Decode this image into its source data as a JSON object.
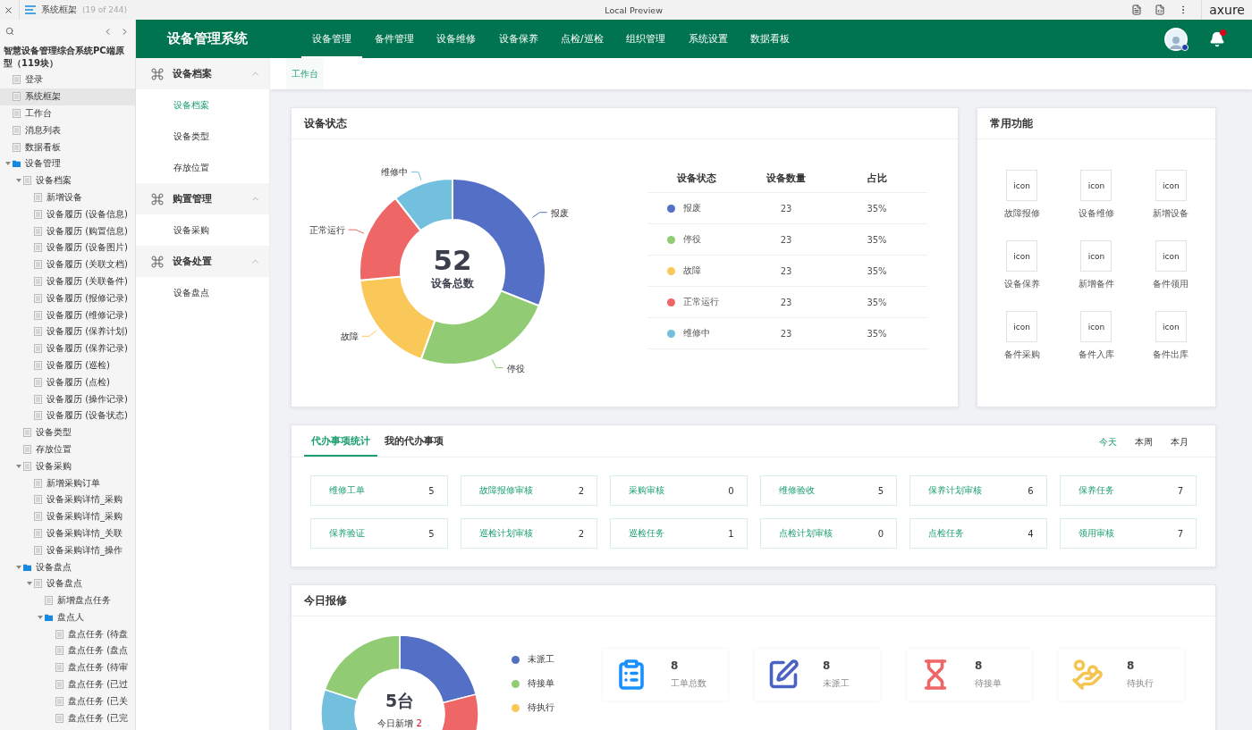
{
  "axure": {
    "title": "系统框架",
    "page_count": "(19 of 244)",
    "preview": "Local Preview",
    "logo": "axure"
  },
  "project": {
    "title": "智慧设备管理综合系统PC端原型（119块）"
  },
  "tree": [
    {
      "label": "登录",
      "kind": "page",
      "selected": false
    },
    {
      "label": "系统框架",
      "kind": "page",
      "selected": true
    },
    {
      "label": "工作台",
      "kind": "page",
      "selected": false
    },
    {
      "label": "消息列表",
      "kind": "page",
      "selected": false
    },
    {
      "label": "数据看板",
      "kind": "page",
      "selected": false
    },
    {
      "label": "设备管理",
      "kind": "folder",
      "selected": false,
      "expanded": true,
      "children": [
        {
          "label": "设备档案",
          "kind": "page",
          "selected": false,
          "expanded": true,
          "children": [
            {
              "label": "新增设备",
              "kind": "page",
              "selected": false
            },
            {
              "label": "设备履历 (设备信息)",
              "kind": "page",
              "selected": false
            },
            {
              "label": "设备履历 (购置信息)",
              "kind": "page",
              "selected": false
            },
            {
              "label": "设备履历 (设备图片)",
              "kind": "page",
              "selected": false
            },
            {
              "label": "设备履历 (关联文档)",
              "kind": "page",
              "selected": false
            },
            {
              "label": "设备履历 (关联备件)",
              "kind": "page",
              "selected": false
            },
            {
              "label": "设备履历 (报修记录)",
              "kind": "page",
              "selected": false
            },
            {
              "label": "设备履历 (维修记录)",
              "kind": "page",
              "selected": false
            },
            {
              "label": "设备履历 (保养计划)",
              "kind": "page",
              "selected": false
            },
            {
              "label": "设备履历 (保养记录)",
              "kind": "page",
              "selected": false
            },
            {
              "label": "设备履历 (巡检)",
              "kind": "page",
              "selected": false
            },
            {
              "label": "设备履历 (点检)",
              "kind": "page",
              "selected": false
            },
            {
              "label": "设备履历 (操作记录)",
              "kind": "page",
              "selected": false
            },
            {
              "label": "设备履历 (设备状态)",
              "kind": "page",
              "selected": false
            }
          ]
        },
        {
          "label": "设备类型",
          "kind": "page",
          "selected": false
        },
        {
          "label": "存放位置",
          "kind": "page",
          "selected": false
        },
        {
          "label": "设备采购",
          "kind": "page",
          "selected": false,
          "expanded": true,
          "children": [
            {
              "label": "新增采购订单",
              "kind": "page",
              "selected": false
            },
            {
              "label": "设备采购详情_采购",
              "kind": "page",
              "selected": false
            },
            {
              "label": "设备采购详情_采购",
              "kind": "page",
              "selected": false
            },
            {
              "label": "设备采购详情_关联",
              "kind": "page",
              "selected": false
            },
            {
              "label": "设备采购详情_操作",
              "kind": "page",
              "selected": false
            }
          ]
        },
        {
          "label": "设备盘点",
          "kind": "folder",
          "selected": false,
          "expanded": true,
          "children": [
            {
              "label": "设备盘点",
              "kind": "page",
              "selected": false,
              "expanded": true,
              "children": [
                {
                  "label": "新增盘点任务",
                  "kind": "page",
                  "selected": false
                },
                {
                  "label": "盘点人",
                  "kind": "folder",
                  "selected": false,
                  "expanded": true,
                  "children": [
                    {
                      "label": "盘点任务 (待盘",
                      "kind": "page",
                      "selected": false
                    },
                    {
                      "label": "盘点任务 (盘点",
                      "kind": "page",
                      "selected": false
                    },
                    {
                      "label": "盘点任务 (待审",
                      "kind": "page",
                      "selected": false
                    },
                    {
                      "label": "盘点任务 (已过",
                      "kind": "page",
                      "selected": false
                    },
                    {
                      "label": "盘点任务 (已关",
                      "kind": "page",
                      "selected": false
                    },
                    {
                      "label": "盘点任务 (已完",
                      "kind": "page",
                      "selected": false
                    }
                  ]
                }
              ]
            }
          ]
        }
      ]
    }
  ],
  "app": {
    "title": "设备管理系统",
    "nav": [
      {
        "label": "设备管理",
        "selected": true
      },
      {
        "label": "备件管理",
        "selected": false
      },
      {
        "label": "设备维修",
        "selected": false
      },
      {
        "label": "设备保养",
        "selected": false
      },
      {
        "label": "点检/巡检",
        "selected": false
      },
      {
        "label": "组织管理",
        "selected": false
      },
      {
        "label": "系统设置",
        "selected": false
      },
      {
        "label": "数据看板",
        "selected": false
      }
    ],
    "notifications": true
  },
  "submenu": [
    {
      "title": "设备档案",
      "expanded": true,
      "items": [
        {
          "label": "设备档案",
          "selected": true
        },
        {
          "label": "设备类型",
          "selected": false
        },
        {
          "label": "存放位置",
          "selected": false
        }
      ]
    },
    {
      "title": "购置管理",
      "expanded": true,
      "items": [
        {
          "label": "设备采购",
          "selected": false
        }
      ]
    },
    {
      "title": "设备处置",
      "expanded": true,
      "items": [
        {
          "label": "设备盘点",
          "selected": false
        }
      ]
    }
  ],
  "breadcrumb": [
    {
      "label": "工作台",
      "selected": true
    }
  ],
  "status_card": {
    "title": "设备状态",
    "total": "52",
    "total_label": "设备总数",
    "slices": [
      {
        "label": "报废",
        "color": "#5470c6"
      },
      {
        "label": "停役",
        "color": "#91cc75"
      },
      {
        "label": "故障",
        "color": "#fac858"
      },
      {
        "label": "正常运行",
        "color": "#ee6666"
      },
      {
        "label": "维修中",
        "color": "#73c0de"
      }
    ],
    "columns": [
      "设备状态",
      "设备数量",
      "占比"
    ],
    "rows": [
      {
        "name": "报废",
        "color": "#5470c6",
        "count": "23",
        "share": "35%"
      },
      {
        "name": "停役",
        "color": "#91cc75",
        "count": "23",
        "share": "35%"
      },
      {
        "name": "故障",
        "color": "#fac858",
        "count": "23",
        "share": "35%"
      },
      {
        "name": "正常运行",
        "color": "#ee6666",
        "count": "23",
        "share": "35%"
      },
      {
        "name": "维修中",
        "color": "#73c0de",
        "count": "23",
        "share": "35%"
      }
    ]
  },
  "quick": {
    "title": "常用功能",
    "items": [
      {
        "icon": "icon",
        "label": "故障报修"
      },
      {
        "icon": "icon",
        "label": "设备维修"
      },
      {
        "icon": "icon",
        "label": "新增设备"
      },
      {
        "icon": "icon",
        "label": "设备保养"
      },
      {
        "icon": "icon",
        "label": "新增备件"
      },
      {
        "icon": "icon",
        "label": "备件领用"
      },
      {
        "icon": "icon",
        "label": "备件采购"
      },
      {
        "icon": "icon",
        "label": "备件入库"
      },
      {
        "icon": "icon",
        "label": "备件出库"
      }
    ]
  },
  "todo": {
    "tabs": [
      {
        "label": "代办事项统计",
        "selected": true
      },
      {
        "label": "我的代办事项",
        "selected": false
      }
    ],
    "ranges": [
      {
        "label": "今天",
        "selected": true
      },
      {
        "label": "本周",
        "selected": false
      },
      {
        "label": "本月",
        "selected": false
      }
    ],
    "tiles": [
      {
        "label": "维修工单",
        "count": "5"
      },
      {
        "label": "故障报修审核",
        "count": "2"
      },
      {
        "label": "采购审核",
        "count": "0"
      },
      {
        "label": "维修验收",
        "count": "5"
      },
      {
        "label": "保养计划审核",
        "count": "6"
      },
      {
        "label": "保养任务",
        "count": "7"
      },
      {
        "label": "保养验证",
        "count": "5"
      },
      {
        "label": "巡检计划审核",
        "count": "2"
      },
      {
        "label": "巡检任务",
        "count": "1"
      },
      {
        "label": "点检计划审核",
        "count": "0"
      },
      {
        "label": "点检任务",
        "count": "4"
      },
      {
        "label": "领用审核",
        "count": "7"
      }
    ]
  },
  "repair": {
    "title": "今日报修",
    "center_value": "5台",
    "center_label": "今日新增",
    "center_count": "2",
    "legend": [
      {
        "label": "未派工",
        "color": "#5470c6"
      },
      {
        "label": "待接单",
        "color": "#91cc75"
      },
      {
        "label": "待执行",
        "color": "#fac858"
      }
    ],
    "stats": [
      {
        "kind": "clipboard",
        "value": "8",
        "label": "工单总数"
      },
      {
        "kind": "edit",
        "value": "8",
        "label": "未派工"
      },
      {
        "kind": "hourglass",
        "value": "8",
        "label": "待接单"
      },
      {
        "kind": "hand",
        "value": "8",
        "label": "待执行"
      }
    ]
  }
}
